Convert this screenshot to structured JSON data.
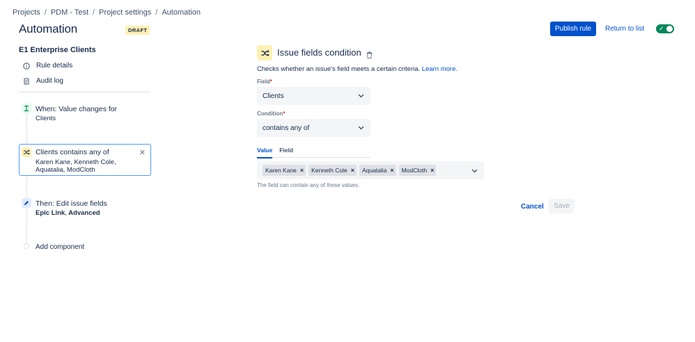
{
  "breadcrumb": [
    "Projects",
    "PDM - Test",
    "Project settings",
    "Automation"
  ],
  "header": {
    "title": "Automation",
    "badge": "DRAFT",
    "publish_label": "Publish rule",
    "return_label": "Return to list"
  },
  "sidebar": {
    "rule_name": "E1 Enterprise Clients",
    "nav": [
      {
        "label": "Rule details",
        "icon": "info-icon"
      },
      {
        "label": "Audit log",
        "icon": "document-icon"
      }
    ],
    "trigger": {
      "title": "When: Value changes for",
      "subtitle": "Clients"
    },
    "condition": {
      "title": "Clients contains any of",
      "subtitle": "Karen Kane, Kenneth Cole, Aquatalia, ModCloth"
    },
    "action": {
      "title": "Then: Edit issue fields",
      "field1": "Epic Link",
      "separator": ",",
      "field2": "Advanced"
    },
    "add_component": "Add component"
  },
  "panel": {
    "heading": "Issue fields condition",
    "description": "Checks whether an issue's field meets a certain criteria.",
    "learn_more": "Learn more.",
    "field_label": "Field",
    "field_value": "Clients",
    "condition_label": "Condition",
    "condition_value": "contains any of",
    "tabs": [
      "Value",
      "Field"
    ],
    "values": [
      "Karen Kane",
      "Kenneth Cole",
      "Aquatalia",
      "ModCloth"
    ],
    "help_text": "The field can contain any of these values.",
    "cancel_label": "Cancel",
    "save_label": "Save"
  },
  "colors": {
    "primary": "#0052cc",
    "toggle_on": "#00875a",
    "badge_bg": "#fff0b3",
    "selected_border": "#4c9aff"
  }
}
